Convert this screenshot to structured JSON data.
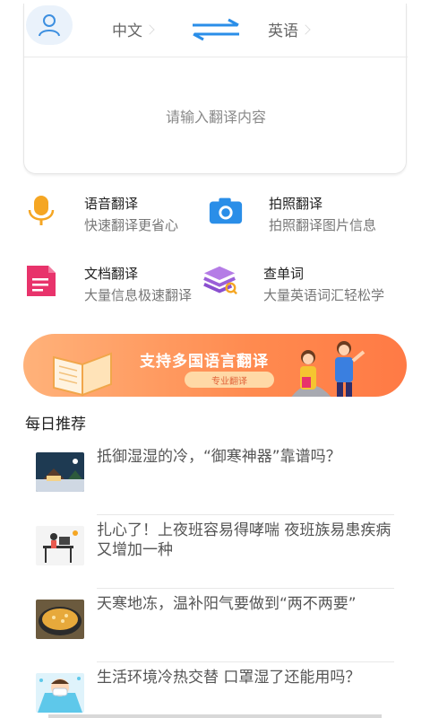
{
  "lang_bar": {
    "source_lang": "中文",
    "target_lang": "英语",
    "swap_icon": "swap-arrows-icon",
    "avatar_icon": "user-icon"
  },
  "input": {
    "placeholder": "请输入翻译内容"
  },
  "features": [
    {
      "title": "语音翻译",
      "desc": "快速翻译更省心",
      "icon": "microphone-icon"
    },
    {
      "title": "拍照翻译",
      "desc": "拍照翻译图片信息",
      "icon": "camera-icon"
    },
    {
      "title": "文档翻译",
      "desc": "大量信息极速翻译",
      "icon": "document-icon"
    },
    {
      "title": "查单词",
      "desc": "大量英语词汇轻松学",
      "icon": "books-search-icon"
    }
  ],
  "banner": {
    "title": "支持多国语言翻译",
    "button": "专业翻译"
  },
  "section_title": "每日推荐",
  "news": [
    {
      "title": "抵御湿湿的冷，“御寒神器”靠谱吗？"
    },
    {
      "title": "扎心了！上夜班容易得哮喘 夜班族易患疾病又增加一种"
    },
    {
      "title": "天寒地冻，温补阳气要做到“两不两要”"
    },
    {
      "title": "生活环境冷热交替 口罩湿了还能用吗？"
    }
  ],
  "colors": {
    "accent_blue": "#2a8ee8",
    "banner_orange": "#ff8a4f",
    "mic_orange": "#f5a623",
    "doc_pink": "#e8336b"
  }
}
